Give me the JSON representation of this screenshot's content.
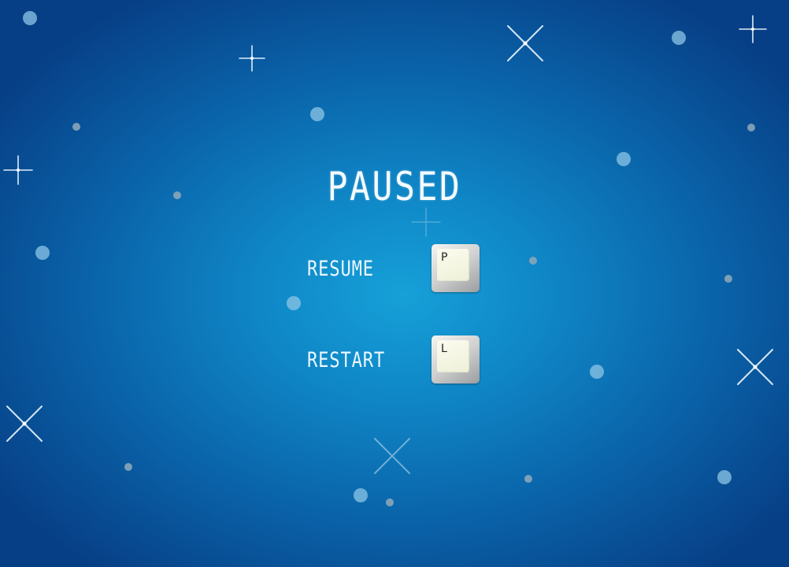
{
  "screen": {
    "title": "PAUSED"
  },
  "menu": {
    "items": [
      {
        "label": "RESUME",
        "key": "P"
      },
      {
        "label": "RESTART",
        "key": "L"
      }
    ]
  },
  "colors": {
    "background_center": "#16a0d8",
    "background_edge": "#073f86",
    "text": "#f4fbff"
  }
}
